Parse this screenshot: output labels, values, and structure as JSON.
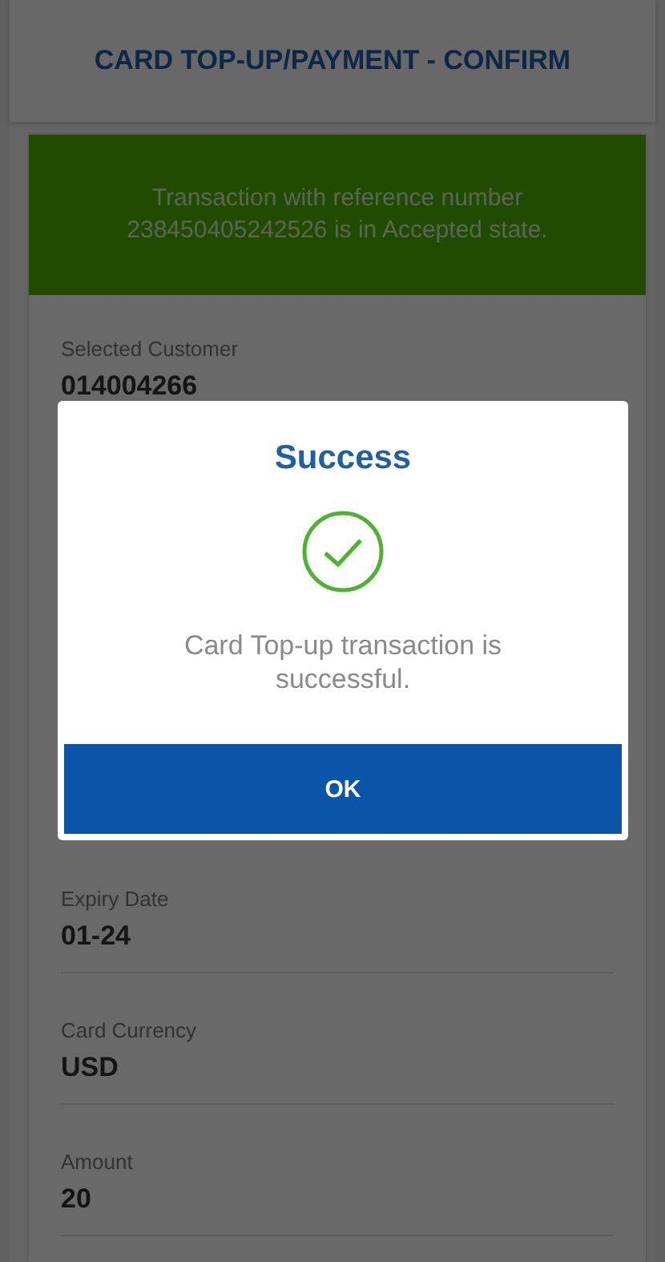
{
  "header": {
    "title": "CARD TOP-UP/PAYMENT - CONFIRM"
  },
  "banner": {
    "message": "Transaction with reference  number 238450405242526 is in Accepted state."
  },
  "fields_top": [
    {
      "label": "Selected Customer",
      "value": "014004266"
    }
  ],
  "fields_bottom": [
    {
      "label": "Expiry Date",
      "value": "01-24"
    },
    {
      "label": "Card Currency",
      "value": "USD"
    },
    {
      "label": "Amount",
      "value": "20"
    }
  ],
  "dialog": {
    "title": "Success",
    "message": "Card Top-up transaction is successful.",
    "button": "OK"
  }
}
